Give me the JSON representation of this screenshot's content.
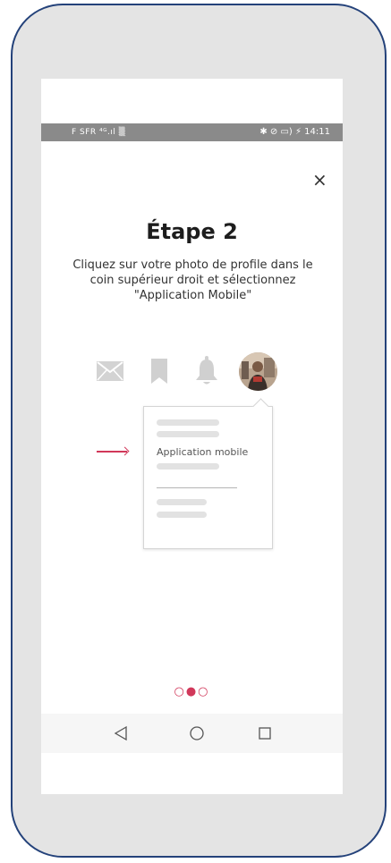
{
  "status_bar": {
    "carrier": "F SFR ⁴ᴳ.ıl ▒",
    "right": "✱ ⊘ ▭) ⚡ 14:11"
  },
  "onboarding": {
    "close_label": "×",
    "title": "Étape 2",
    "description": "Cliquez sur votre photo de profile dans le coin supérieur droit et sélectionnez \"Application Mobile\"",
    "dropdown_item": "Application mobile",
    "pagination": "○●○",
    "current_page": 2,
    "total_pages": 3
  },
  "icons": [
    "mail-icon",
    "bookmark-icon",
    "bell-icon",
    "avatar"
  ],
  "colors": {
    "accent": "#d1385a",
    "frame_border": "#24427a",
    "frame_fill": "#e4e4e4",
    "icon_gray": "#cdcdcd"
  }
}
